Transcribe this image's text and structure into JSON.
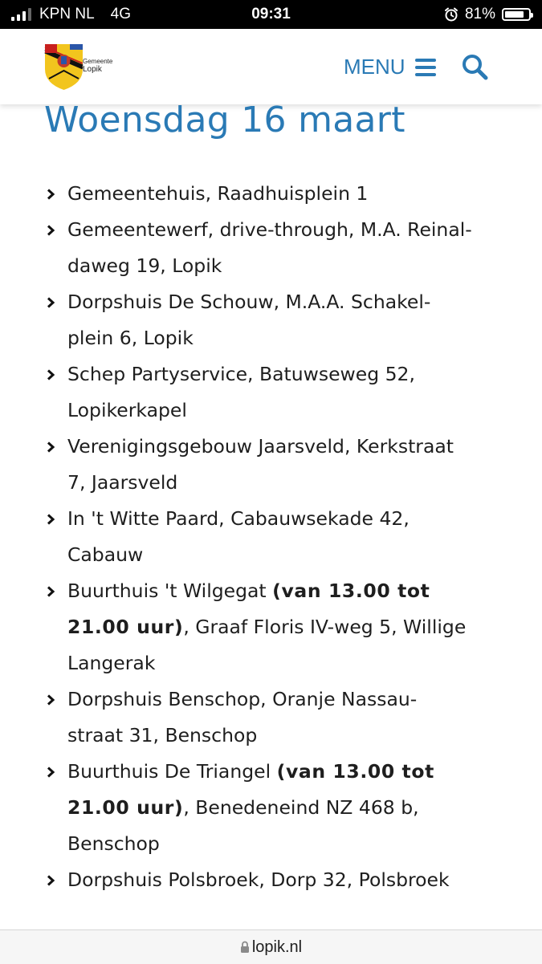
{
  "status_bar": {
    "carrier": "KPN NL",
    "network": "4G",
    "time": "09:31",
    "battery": "81%",
    "battery_level": 0.81
  },
  "header": {
    "logo_line1": "Gemeente",
    "logo_line2": "Lopik",
    "menu_label": "MENU"
  },
  "page": {
    "title": "Woensdag 16 maart",
    "locations": [
      {
        "line1": "Gemeentehuis, Raadhuisplein 1"
      },
      {
        "line1": "Gemeentewerf, drive-through, M.A. Reinal-",
        "line2": "daweg 19, Lopik"
      },
      {
        "line1": "Dorpshuis De Schouw, M.A.A. Schakel-",
        "line2": "plein 6, Lopik"
      },
      {
        "line1": "Schep Partyservice, Batuwseweg 52,",
        "line2": "Lopikerkapel"
      },
      {
        "line1": "Verenigingsgebouw Jaarsveld, Kerkstraat",
        "line2": "7, Jaarsveld"
      },
      {
        "line1": "In 't Witte Paard, Cabauwsekade 42,",
        "line2": "Cabauw"
      },
      {
        "line1": "Buurthuis 't Wilgegat ",
        "bold1": "(van 13.00 tot",
        "bold2": "21.00 uur)",
        "line2": ", Graaf Floris IV-weg 5, Willige",
        "line3": "Langerak"
      },
      {
        "line1": "Dorpshuis Benschop, Oranje Nassau-",
        "line2": "straat 31, Benschop"
      },
      {
        "line1": "Buurthuis De Triangel ",
        "bold1": "(van 13.00 tot",
        "bold2": "21.00 uur)",
        "line2": ", Benedeneind NZ 468 b,",
        "line3": "Benschop"
      },
      {
        "line1": "Dorpshuis Polsbroek, Dorp 32, Polsbroek"
      }
    ]
  },
  "url_bar": {
    "url": "lopik.nl"
  },
  "icons": {
    "signal": "signal-icon",
    "alarm": "alarm-icon",
    "battery": "battery-icon",
    "menu": "hamburger-icon",
    "search": "search-icon",
    "bullet": "chevron-right-icon",
    "lock": "lock-icon"
  },
  "colors": {
    "accent": "#2a7ab5",
    "text": "#1e1e1e",
    "status_bar_bg": "#000000",
    "crest_yellow": "#f2c51e"
  }
}
